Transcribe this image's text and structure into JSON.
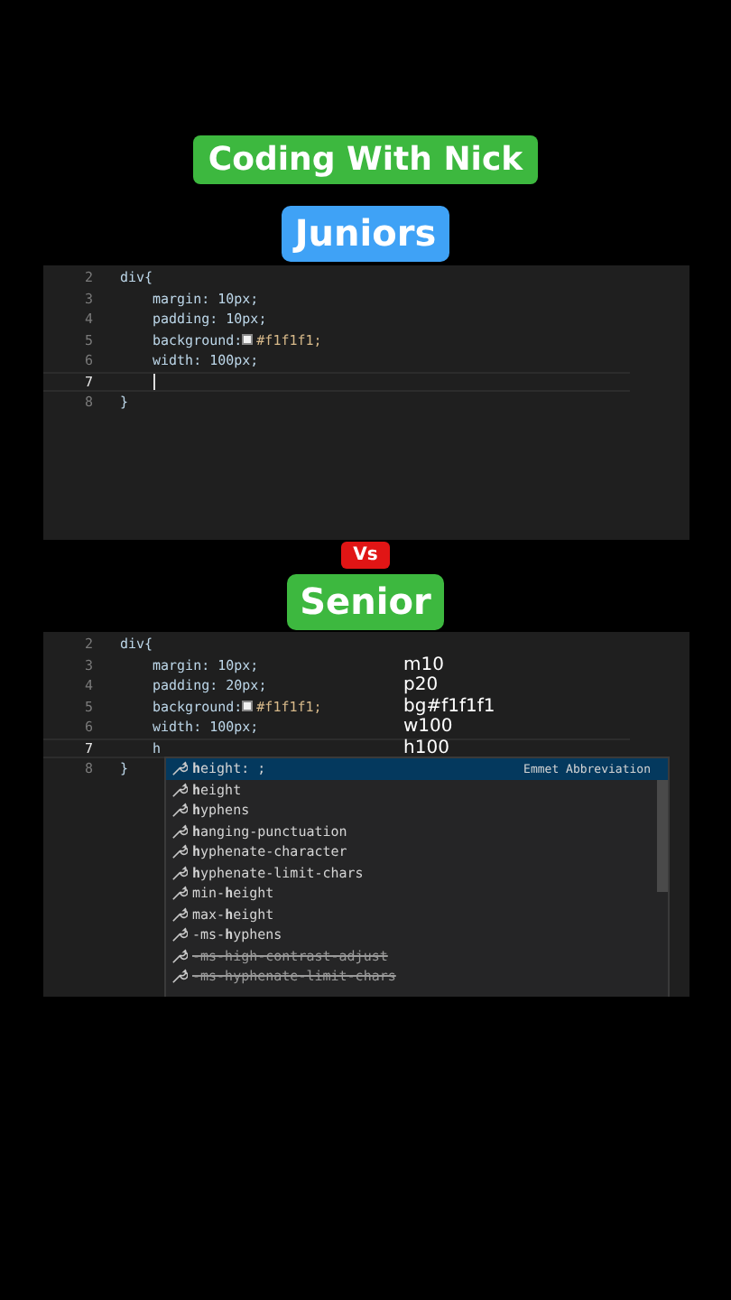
{
  "title": "Coding With Nick",
  "panels": [
    {
      "label": "Juniors",
      "kind": "junior",
      "lines": [
        {
          "num": "2",
          "text": "div{",
          "current": false,
          "children": [
            {
              "num": "3",
              "text": "margin: 10px;",
              "current": false
            },
            {
              "num": "4",
              "text": "padding: 10px;",
              "current": false
            },
            {
              "num": "5",
              "text": "background: ",
              "color": "#f1f1f1",
              "after": "#f1f1f1;",
              "current": false
            },
            {
              "num": "6",
              "text": "width: 100px;",
              "current": false
            },
            {
              "num": "7",
              "current": true,
              "cursor": true
            }
          ]
        },
        {
          "num": "8",
          "text": "}",
          "current": false
        }
      ]
    },
    {
      "label": "Senior",
      "kind": "senior",
      "badge": "Vs",
      "lines": [
        {
          "num": "2",
          "text": "div{",
          "current": false,
          "children": [
            {
              "num": "3",
              "text": "margin: 10px;",
              "note": "m10",
              "current": false
            },
            {
              "num": "4",
              "text": "padding: 20px;",
              "note": "p20",
              "current": false
            },
            {
              "num": "5",
              "text": "background: ",
              "color": "#f1f1f1",
              "after": "#f1f1f1;",
              "note": "bg#f1f1f1",
              "current": false
            },
            {
              "num": "6",
              "text": "width: 100px;",
              "note": "w100",
              "current": false
            },
            {
              "num": "7",
              "text": "h",
              "note": "h100",
              "current": true
            }
          ]
        },
        {
          "num": "8",
          "text": "}",
          "current": false
        }
      ],
      "suggestions": [
        {
          "label": "**h**eight: ;",
          "detail": "Emmet Abbreviation",
          "selected": true,
          "deprecated": false
        },
        {
          "label": "**h**eight",
          "selected": false,
          "deprecated": false
        },
        {
          "label": "**h**yphens",
          "selected": false,
          "deprecated": false
        },
        {
          "label": "**h**anging-punctuation",
          "selected": false,
          "deprecated": false
        },
        {
          "label": "**h**yphenate-character",
          "selected": false,
          "deprecated": false
        },
        {
          "label": "**h**yphenate-limit-chars",
          "selected": false,
          "deprecated": false
        },
        {
          "label": "min-**h**eight",
          "selected": false,
          "deprecated": false
        },
        {
          "label": "max-**h**eight",
          "selected": false,
          "deprecated": false
        },
        {
          "label": "-ms-**h**yphens",
          "selected": false,
          "deprecated": false
        },
        {
          "label": "-ms-high-contrast-adjust",
          "selected": false,
          "deprecated": true
        },
        {
          "label": "-ms-hyphenate-limit-chars",
          "selected": false,
          "deprecated": true
        }
      ]
    }
  ]
}
